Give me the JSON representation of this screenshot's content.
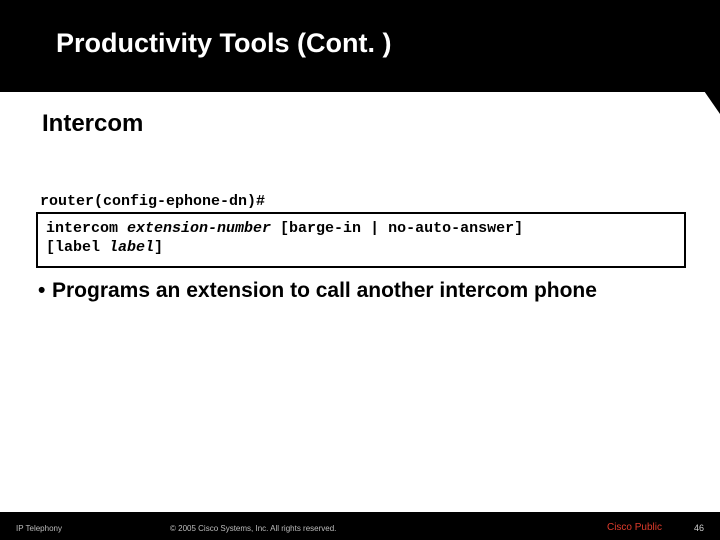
{
  "title": "Productivity Tools (Cont. )",
  "subtitle": "Intercom",
  "prompt": "router(config-ephone-dn)#",
  "cmd_parts": {
    "kw1": "intercom ",
    "arg1": "extension-number",
    "kw2": " [barge-in | no-auto-answer] ",
    "kw3": "[label ",
    "arg2": "label",
    "kw4": "]"
  },
  "bullet": "Programs an extension to call another intercom phone",
  "footer": {
    "left": "IP Telephony",
    "mid": "© 2005 Cisco Systems, Inc. All rights reserved.",
    "public": "Cisco Public",
    "page": "46"
  }
}
